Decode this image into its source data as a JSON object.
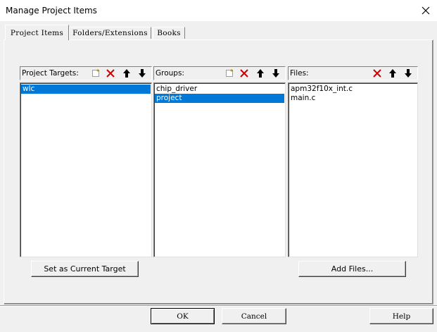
{
  "window": {
    "title": "Manage Project Items"
  },
  "tabs": [
    {
      "label": "Project Items",
      "active": true
    },
    {
      "label": "Folders/Extensions",
      "active": false
    },
    {
      "label": "Books",
      "active": false
    }
  ],
  "targets": {
    "label": "Project Targets:",
    "items": [
      {
        "text": "wlc",
        "selected": true
      }
    ],
    "button": "Set as Current Target"
  },
  "groups": {
    "label": "Groups:",
    "items": [
      {
        "text": "chip_driver",
        "selected": false
      },
      {
        "text": "project",
        "selected": true
      }
    ]
  },
  "files": {
    "label": "Files:",
    "items": [
      {
        "text": "apm32f10x_int.c",
        "selected": false
      },
      {
        "text": "main.c",
        "selected": false
      }
    ],
    "button": "Add Files..."
  },
  "footer": {
    "ok": "OK",
    "cancel": "Cancel",
    "help": "Help"
  },
  "icons": {
    "new": "new-item-icon",
    "delete": "delete-icon",
    "up": "move-up-icon",
    "down": "move-down-icon",
    "close": "close-icon"
  },
  "colors": {
    "selection": "#0078d7",
    "delete_red": "#cc0000"
  }
}
